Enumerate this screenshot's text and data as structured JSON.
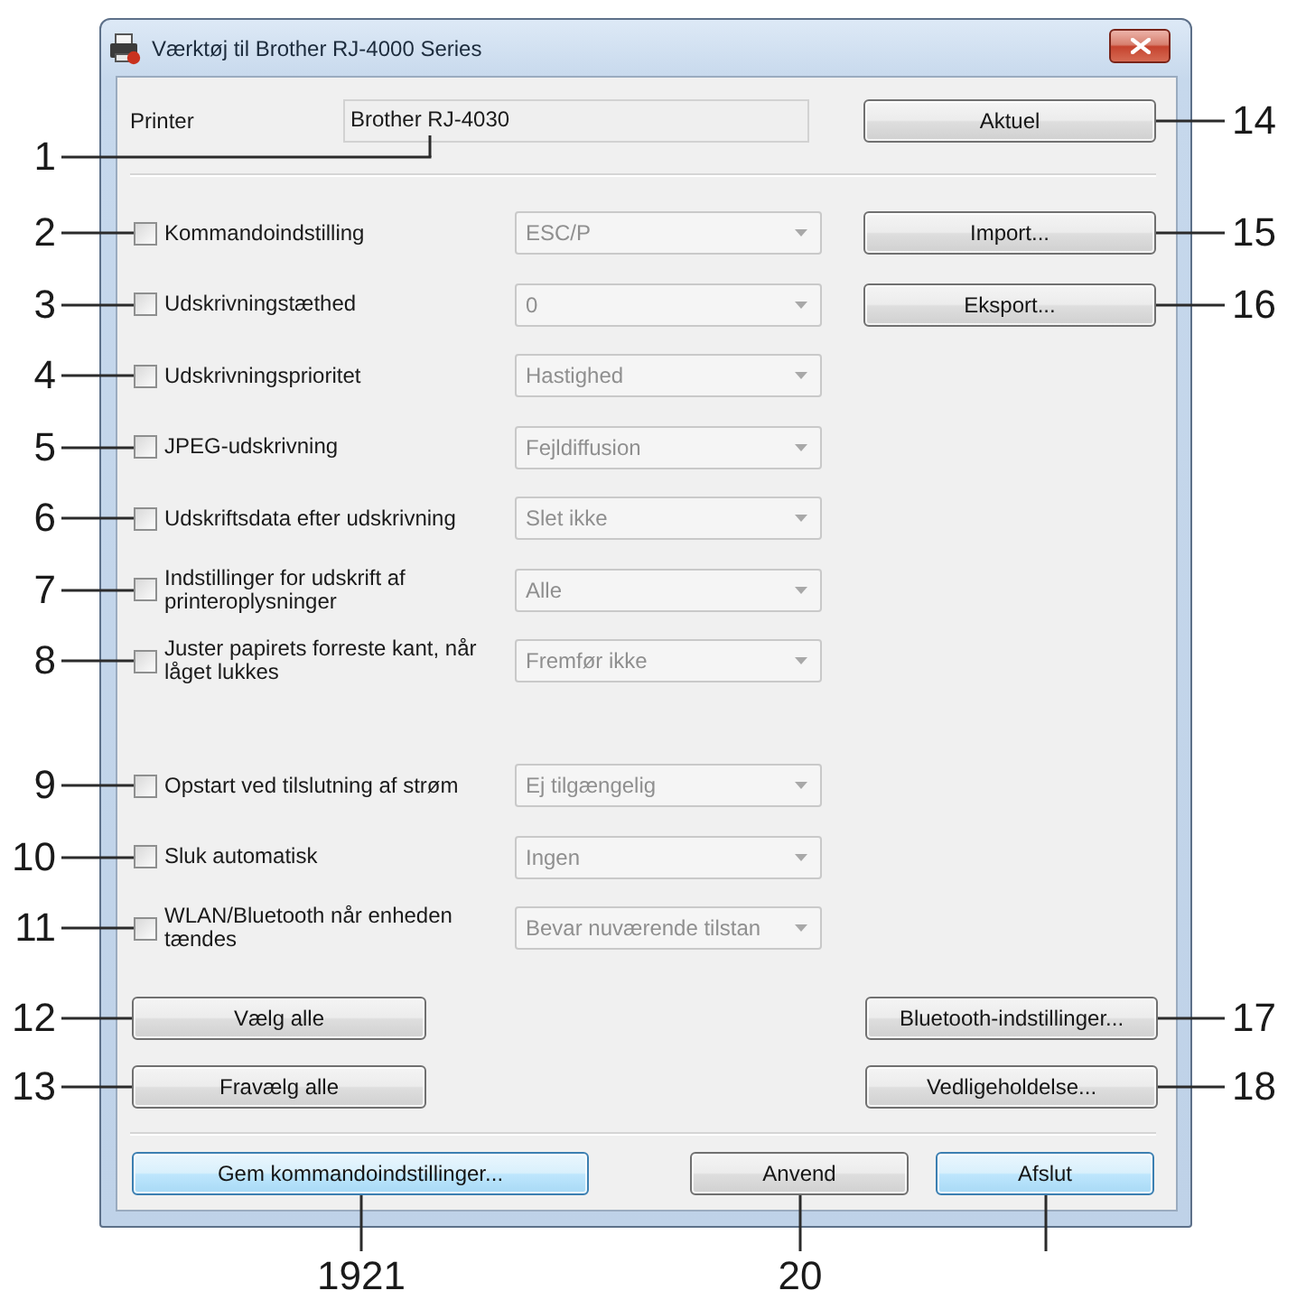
{
  "window": {
    "title": "Værktøj til Brother RJ-4000 Series"
  },
  "printer": {
    "label": "Printer",
    "value": "Brother RJ-4030",
    "callout": "1",
    "button": {
      "label": "Aktuel",
      "highlighted": false,
      "callout": "14"
    }
  },
  "setting_groups": [
    {
      "rows": [
        {
          "label": "Kommandoindstilling",
          "checked": false,
          "value": "ESC/P",
          "disabled": true,
          "callout": "2"
        },
        {
          "label": "Udskrivningstæthed",
          "checked": false,
          "value": "0",
          "disabled": true,
          "callout": "3"
        },
        {
          "label": "Udskrivningsprioritet",
          "checked": false,
          "value": "Hastighed",
          "disabled": true,
          "callout": "4"
        },
        {
          "label": "JPEG-udskrivning",
          "checked": false,
          "value": "Fejldiffusion",
          "disabled": true,
          "callout": "5"
        },
        {
          "label": "Udskriftsdata efter udskrivning",
          "checked": false,
          "value": "Slet ikke",
          "disabled": true,
          "callout": "6"
        },
        {
          "label": "Indstillinger for udskrift af printeroplysninger",
          "checked": false,
          "value": "Alle",
          "disabled": true,
          "callout": "7"
        },
        {
          "label": "Juster papirets forreste kant, når låget lukkes",
          "checked": false,
          "value": "Fremfør ikke",
          "disabled": true,
          "callout": "8"
        }
      ]
    },
    {
      "rows": [
        {
          "label": "Opstart ved tilslutning af strøm",
          "checked": false,
          "value": "Ej tilgængelig",
          "disabled": true,
          "callout": "9"
        },
        {
          "label": "Sluk automatisk",
          "checked": false,
          "value": "Ingen",
          "disabled": true,
          "callout": "10"
        },
        {
          "label": "WLAN/Bluetooth når enheden tændes",
          "checked": false,
          "value": "Bevar nuværende tilstan",
          "disabled": true,
          "callout": "11"
        }
      ]
    }
  ],
  "file_buttons": [
    {
      "label": "Import...",
      "highlighted": false,
      "callout": "15"
    },
    {
      "label": "Eksport...",
      "highlighted": false,
      "callout": "16"
    }
  ],
  "selection_buttons": [
    {
      "label": "Vælg alle",
      "highlighted": false,
      "callout": "12"
    },
    {
      "label": "Fravælg alle",
      "highlighted": false,
      "callout": "13"
    }
  ],
  "device_buttons": [
    {
      "label": "Bluetooth-indstillinger...",
      "highlighted": false,
      "callout": "17"
    },
    {
      "label": "Vedligeholdelse...",
      "highlighted": false,
      "callout": "18"
    }
  ],
  "footer_buttons": [
    {
      "label": "Gem kommandoindstillinger...",
      "highlighted": true,
      "callout": "1921"
    },
    {
      "label": "Anvend",
      "highlighted": false,
      "callout": "20"
    },
    {
      "label": "Afslut",
      "highlighted": true,
      "leader": true
    }
  ]
}
